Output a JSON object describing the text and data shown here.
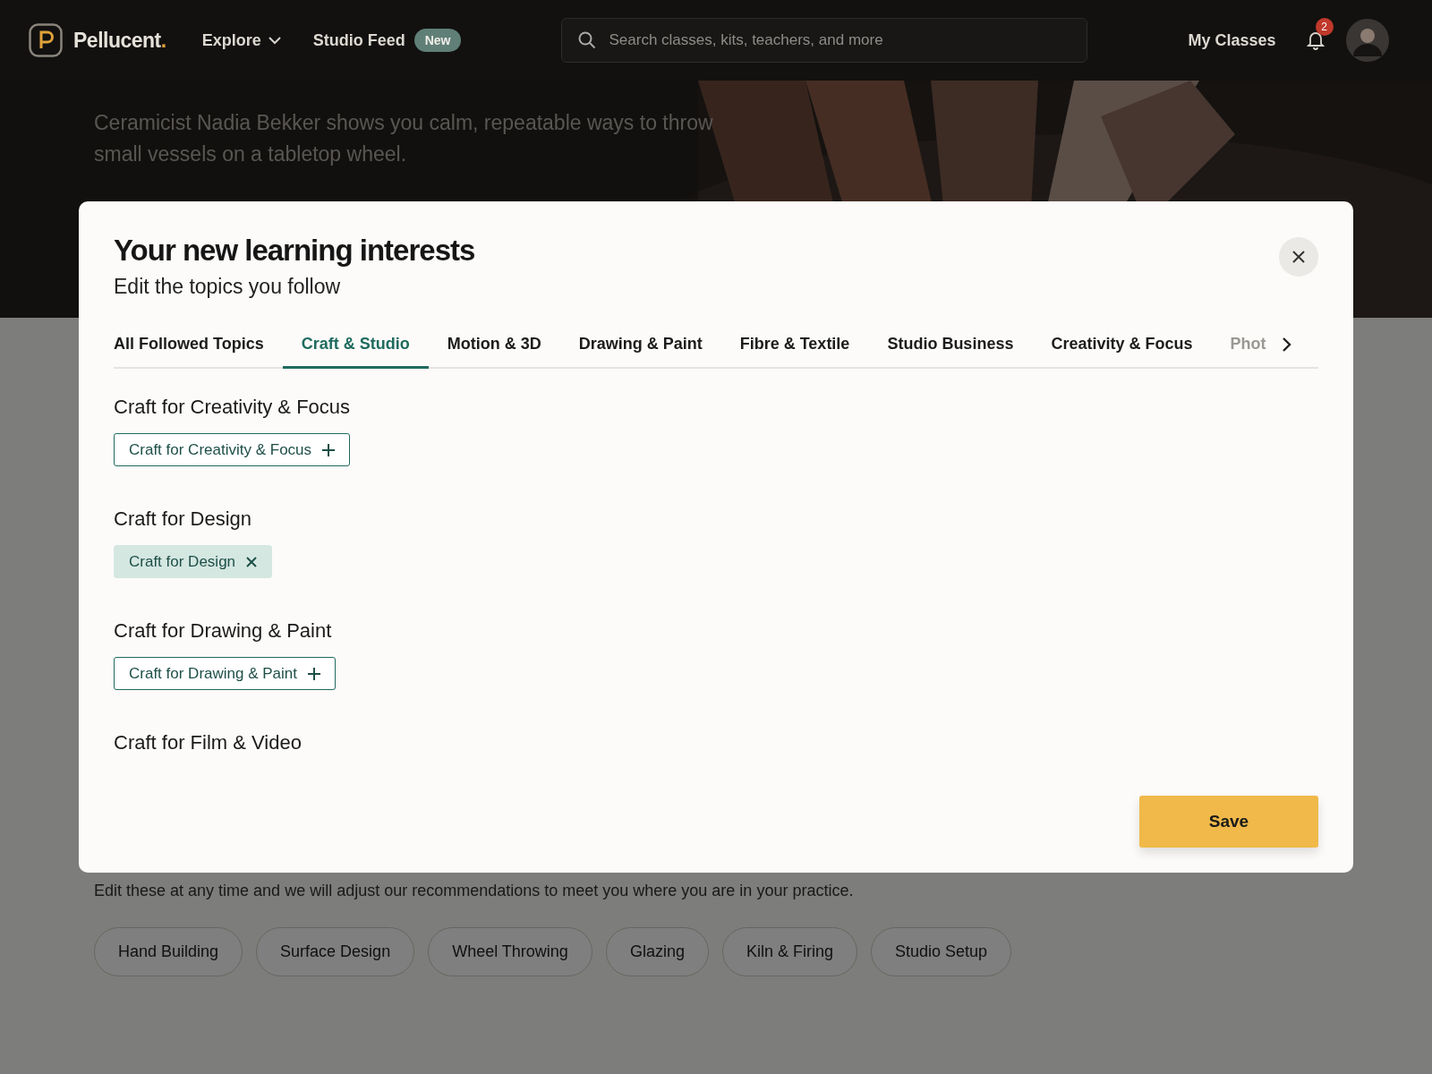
{
  "header": {
    "brand": {
      "name": "Pellucent",
      "mark": "."
    },
    "nav": [
      {
        "label": "Explore",
        "kind": "menu"
      },
      {
        "label": "Studio Feed",
        "kind": "badge",
        "badge": "New"
      }
    ],
    "search": {
      "placeholder": "Search classes, kits, teachers, and more"
    },
    "my_classes": "My Classes",
    "notifications": "2"
  },
  "hero": {
    "description": "Ceramicist Nadia Bekker shows you calm, repeatable ways to throw small vessels on a tabletop wheel."
  },
  "page": {
    "note": "Edit these at any time and we will adjust our recommendations to meet you where you are in your practice.",
    "topics": [
      "Hand Building",
      "Surface Design",
      "Wheel Throwing",
      "Glazing",
      "Kiln & Firing",
      "Studio Setup"
    ]
  },
  "modal": {
    "title": "Your new learning interests",
    "subtitle": "Edit the topics you follow",
    "tabs": [
      {
        "label": "All Followed Topics",
        "selected": false
      },
      {
        "label": "Craft & Studio",
        "selected": true
      },
      {
        "label": "Motion & 3D",
        "selected": false
      },
      {
        "label": "Drawing & Paint",
        "selected": false
      },
      {
        "label": "Fibre & Textile",
        "selected": false
      },
      {
        "label": "Studio Business",
        "selected": false
      },
      {
        "label": "Creativity & Focus",
        "selected": false
      },
      {
        "label": "Phot",
        "selected": false
      }
    ],
    "sections": [
      {
        "heading": "Craft for Creativity & Focus",
        "chip": {
          "label": "Craft for Creativity & Focus",
          "followed": false
        }
      },
      {
        "heading": "Craft for Design",
        "chip": {
          "label": "Craft for Design",
          "followed": true
        }
      },
      {
        "heading": "Craft for Drawing & Paint",
        "chip": {
          "label": "Craft for Drawing & Paint",
          "followed": false
        }
      },
      {
        "heading": "Craft for Film & Video"
      }
    ],
    "save": "Save"
  }
}
